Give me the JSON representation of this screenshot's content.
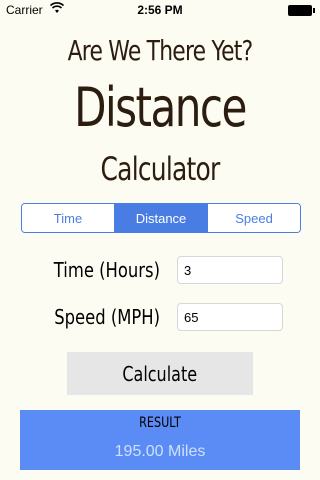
{
  "status_bar": {
    "carrier": "Carrier",
    "time": "2:56 PM"
  },
  "header": {
    "line1": "Are We There Yet?",
    "line2": "Distance",
    "line3": "Calculator"
  },
  "segments": {
    "items": [
      "Time",
      "Distance",
      "Speed"
    ],
    "selected": "Distance"
  },
  "form": {
    "time_label": "Time (Hours)",
    "time_value": "3",
    "speed_label": "Speed (MPH)",
    "speed_value": "65"
  },
  "calculate_label": "Calculate",
  "result": {
    "label": "RESULT",
    "value": "195.00 Miles"
  },
  "colors": {
    "accent": "#4a7de3",
    "result_bg": "#5b8cf5",
    "title_text": "#2b1d10"
  }
}
